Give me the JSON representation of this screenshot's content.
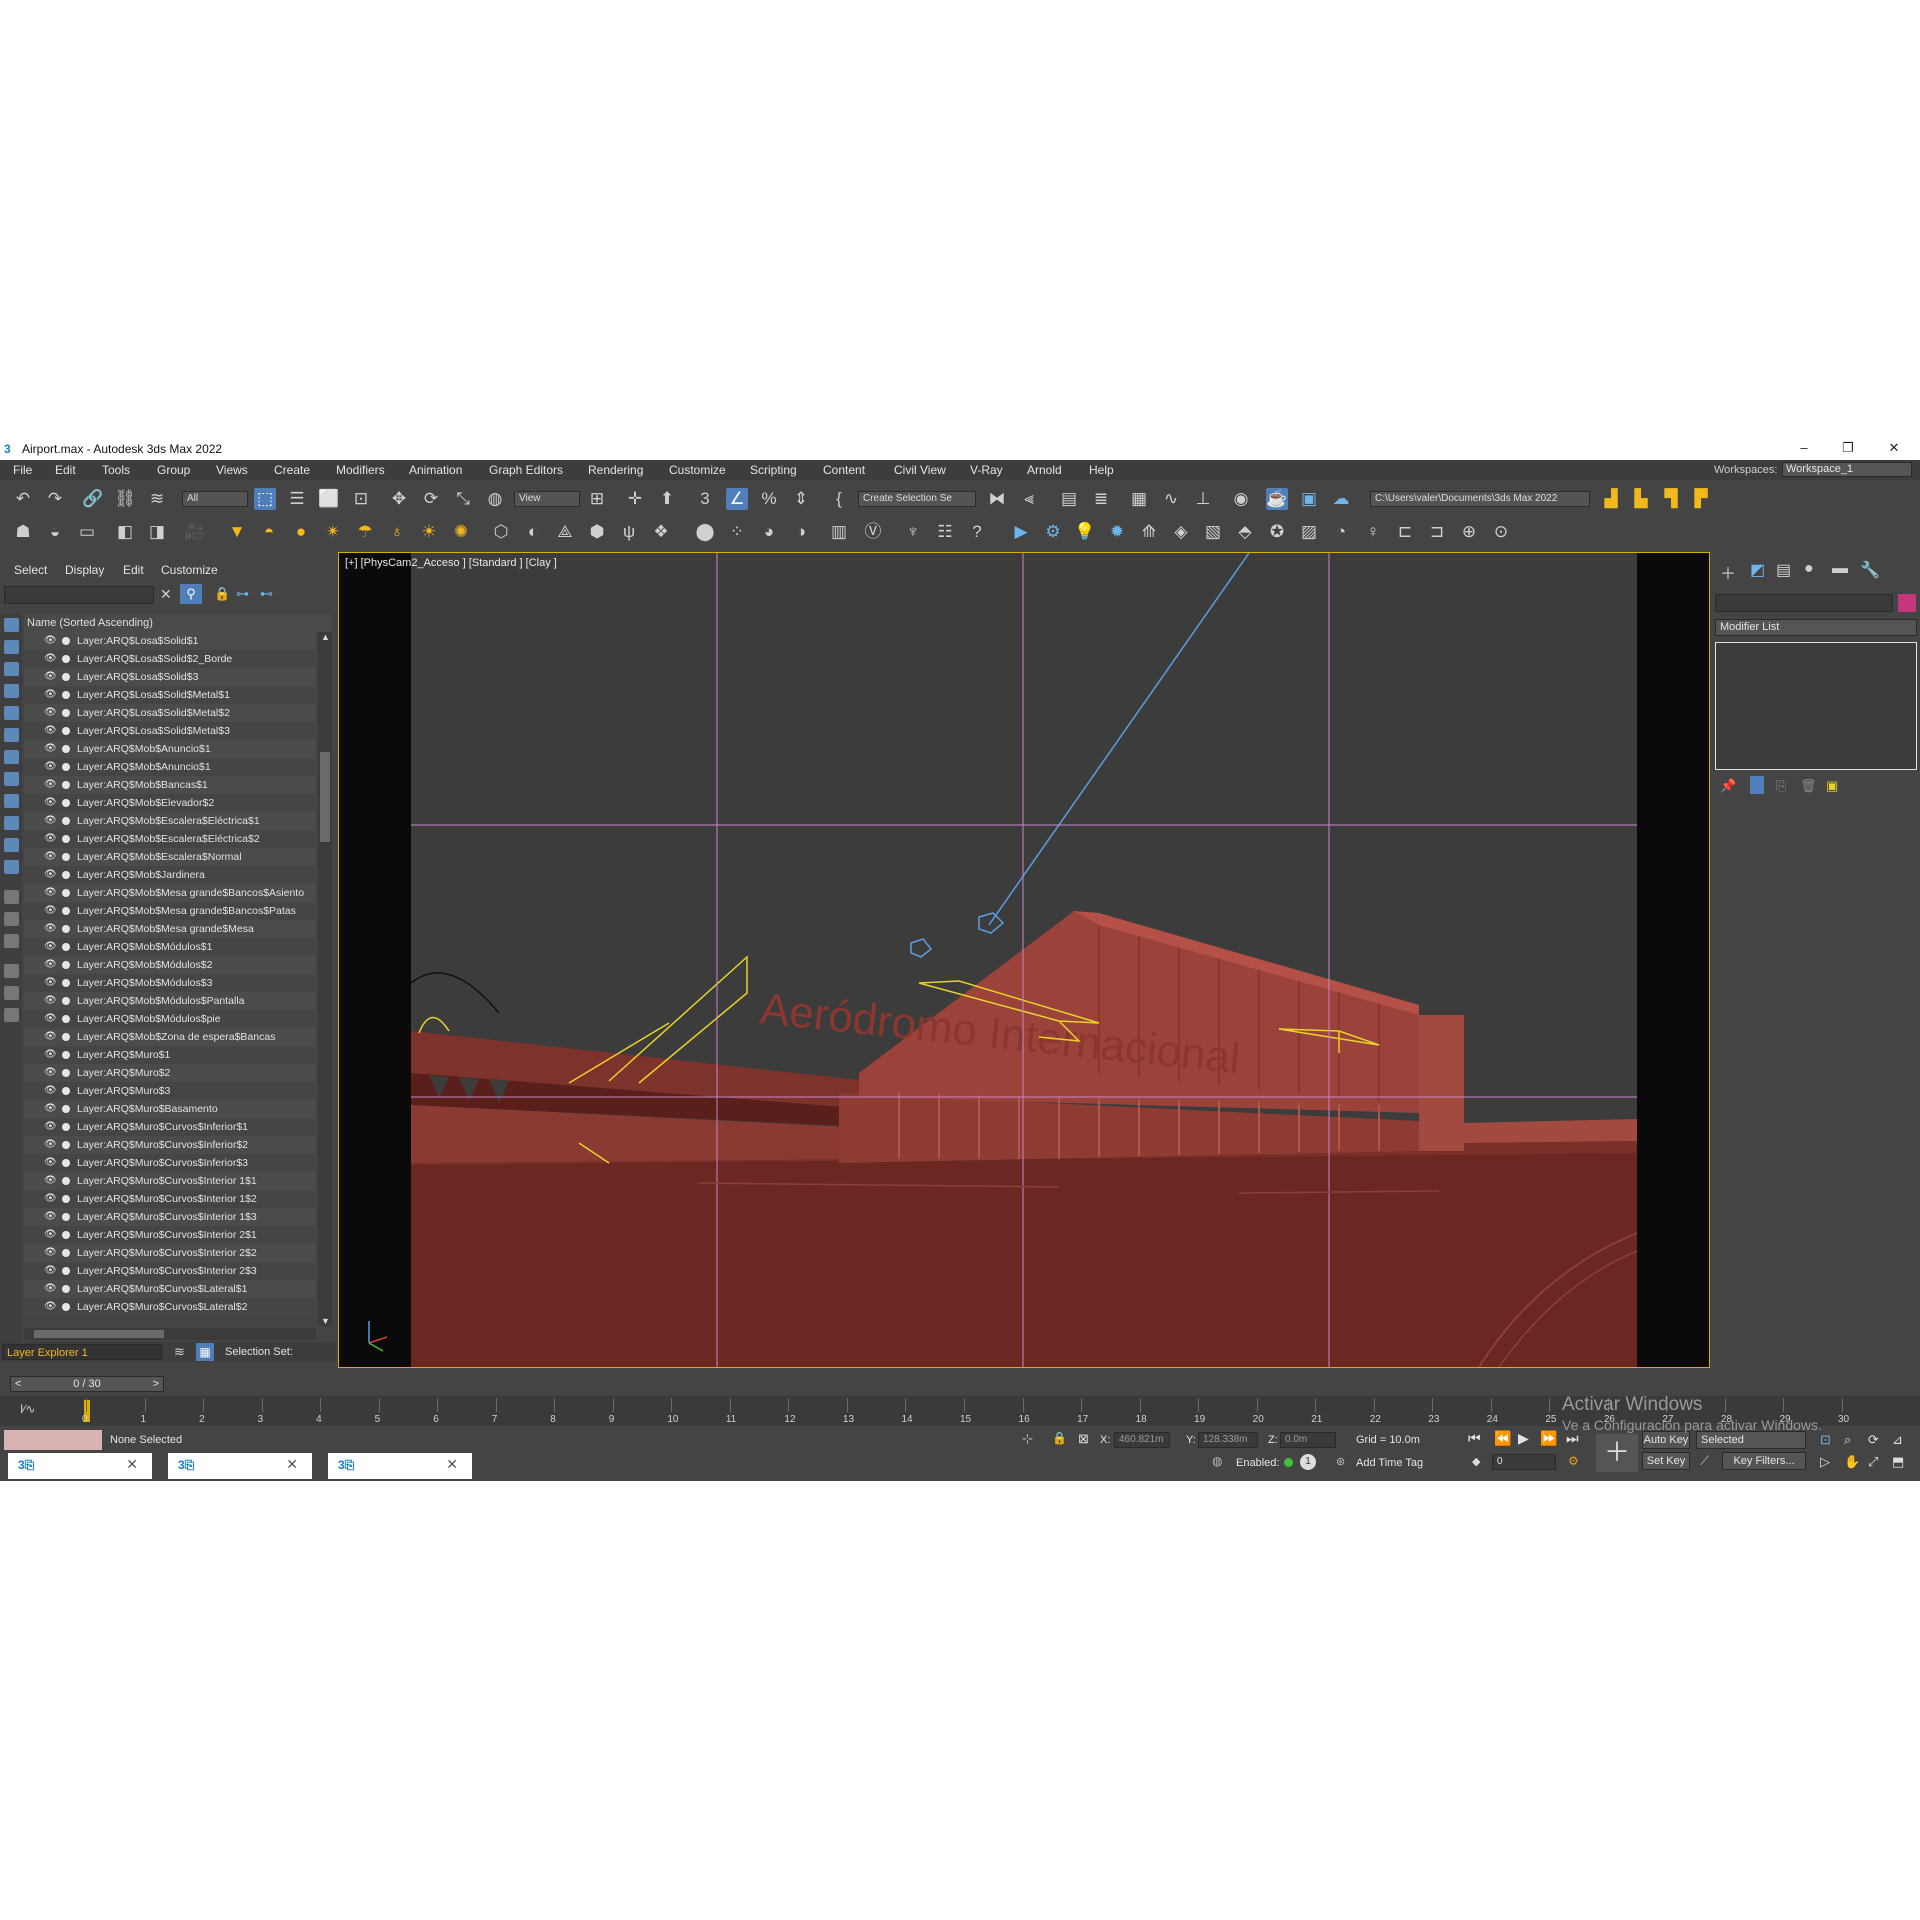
{
  "window": {
    "title": "Airport.max - Autodesk 3ds Max 2022",
    "app_icon": "3",
    "minimize": "–",
    "maximize": "❐",
    "close": "✕"
  },
  "menu": [
    "File",
    "Edit",
    "Tools",
    "Group",
    "Views",
    "Create",
    "Modifiers",
    "Animation",
    "Graph Editors",
    "Rendering",
    "Customize",
    "Scripting",
    "Content",
    "Civil View",
    "V-Ray",
    "Arnold",
    "Help"
  ],
  "workspace": {
    "label": "Workspaces:",
    "value": "Workspace_1"
  },
  "toolbar": {
    "filter_value": "All",
    "refcoord_value": "View",
    "selection_set_value": "Create Selection Se",
    "project_path": "C:\\Users\\valer\\Documents\\3ds Max 2022"
  },
  "scene_explorer": {
    "menu": [
      "Select",
      "Display",
      "Edit",
      "Customize"
    ],
    "column_header": "Name (Sorted Ascending)",
    "layers": [
      "Layer:ARQ$Losa$Solid$1",
      "Layer:ARQ$Losa$Solid$2_Borde",
      "Layer:ARQ$Losa$Solid$3",
      "Layer:ARQ$Losa$Solid$Metal$1",
      "Layer:ARQ$Losa$Solid$Metal$2",
      "Layer:ARQ$Losa$Solid$Metal$3",
      "Layer:ARQ$Mob$Anuncio$1",
      "Layer:ARQ$Mob$Anuncio$1",
      "Layer:ARQ$Mob$Bancas$1",
      "Layer:ARQ$Mob$Elevador$2",
      "Layer:ARQ$Mob$Escalera$Eléctrica$1",
      "Layer:ARQ$Mob$Escalera$Eléctrica$2",
      "Layer:ARQ$Mob$Escalera$Normal",
      "Layer:ARQ$Mob$Jardinera",
      "Layer:ARQ$Mob$Mesa grande$Bancos$Asiento",
      "Layer:ARQ$Mob$Mesa grande$Bancos$Patas",
      "Layer:ARQ$Mob$Mesa grande$Mesa",
      "Layer:ARQ$Mob$Módulos$1",
      "Layer:ARQ$Mob$Módulos$2",
      "Layer:ARQ$Mob$Módulos$3",
      "Layer:ARQ$Mob$Módulos$Pantalla",
      "Layer:ARQ$Mob$Módulos$pie",
      "Layer:ARQ$Mob$Zona de espera$Bancas",
      "Layer:ARQ$Muro$1",
      "Layer:ARQ$Muro$2",
      "Layer:ARQ$Muro$3",
      "Layer:ARQ$Muro$Basamento",
      "Layer:ARQ$Muro$Curvos$Inferior$1",
      "Layer:ARQ$Muro$Curvos$Inferior$2",
      "Layer:ARQ$Muro$Curvos$Inferior$3",
      "Layer:ARQ$Muro$Curvos$Interior 1$1",
      "Layer:ARQ$Muro$Curvos$Interior 1$2",
      "Layer:ARQ$Muro$Curvos$Interior 1$3",
      "Layer:ARQ$Muro$Curvos$Interior 2$1",
      "Layer:ARQ$Muro$Curvos$Interior 2$2",
      "Layer:ARQ$Muro$Curvos$Interior 2$3",
      "Layer:ARQ$Muro$Curvos$Lateral$1",
      "Layer:ARQ$Muro$Curvos$Lateral$2"
    ],
    "explorer_name": "Layer Explorer 1",
    "selection_set_label": "Selection Set:"
  },
  "viewport": {
    "label": "[+] [PhysCam2_Acceso ] [Standard ] [Clay ]",
    "signage": "Aeródromo Internacional"
  },
  "command_panel": {
    "modifier_list": "Modifier List",
    "color_swatch": "#c4377a"
  },
  "timeline": {
    "frame_display": "0 / 30",
    "prev": "<",
    "next": ">",
    "ticks": [
      "0",
      "1",
      "2",
      "3",
      "4",
      "5",
      "6",
      "7",
      "8",
      "9",
      "10",
      "11",
      "12",
      "13",
      "14",
      "15",
      "16",
      "17",
      "18",
      "19",
      "20",
      "21",
      "22",
      "23",
      "24",
      "25",
      "26",
      "27",
      "28",
      "29",
      "30"
    ]
  },
  "status": {
    "selection": "None Selected",
    "x_label": "X:",
    "x_value": "460.821m",
    "y_label": "Y:",
    "y_value": "128.338m",
    "z_label": "Z:",
    "z_value": "0.0m",
    "grid": "Grid = 10.0m",
    "enabled_label": "Enabled:",
    "add_time_tag": "Add Time Tag",
    "auto_key": "Auto Key",
    "set_key": "Set Key",
    "key_mode": "Selected",
    "key_filters": "Key Filters...",
    "frame_value": "0",
    "enabled_count": "1"
  },
  "watermark": {
    "line1": "Activar Windows",
    "line2": "Ve a Configuración para activar Windows."
  }
}
